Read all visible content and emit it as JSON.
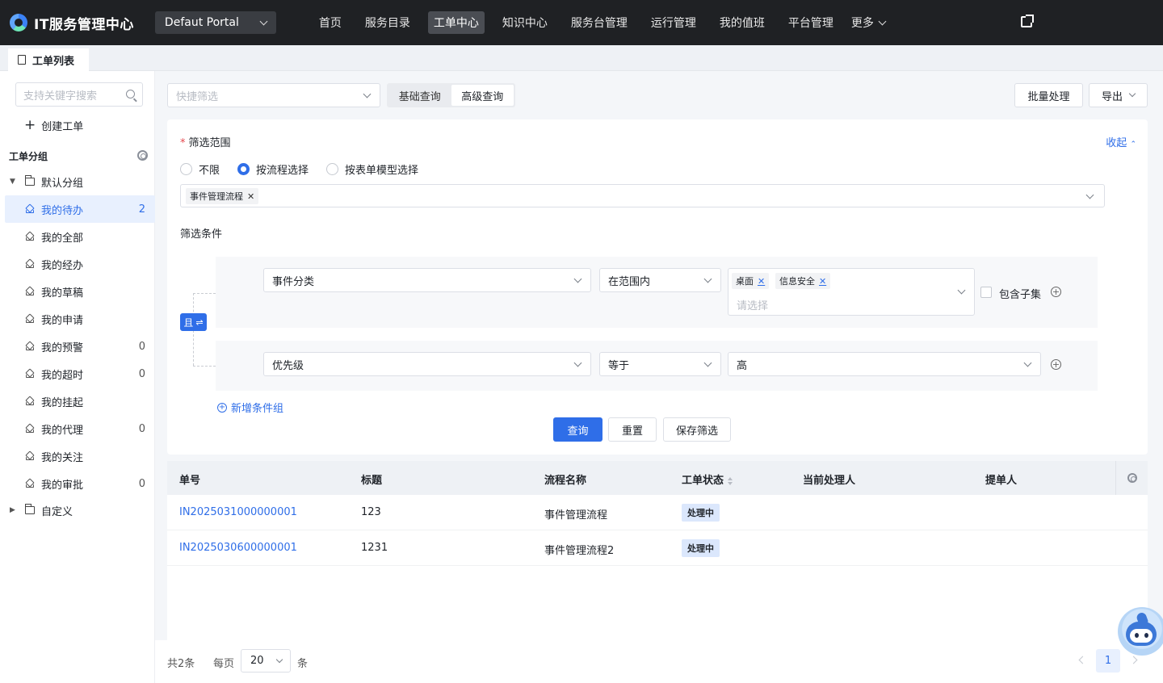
{
  "app": {
    "title": "IT服务管理中心",
    "portal": "Defaut Portal"
  },
  "nav": {
    "items": [
      "首页",
      "服务目录",
      "工单中心",
      "知识中心",
      "服务台管理",
      "运行管理",
      "我的值班",
      "平台管理"
    ],
    "active_index": 2,
    "more": "更多"
  },
  "tab": {
    "label": "工单列表"
  },
  "sidebar": {
    "search_placeholder": "支持关键字搜索",
    "create": "创建工单",
    "group_title": "工单分组",
    "default_group": "默认分组",
    "items": [
      {
        "label": "我的待办",
        "count": "2",
        "active": true
      },
      {
        "label": "我的全部",
        "count": ""
      },
      {
        "label": "我的经办",
        "count": ""
      },
      {
        "label": "我的草稿",
        "count": ""
      },
      {
        "label": "我的申请",
        "count": ""
      },
      {
        "label": "我的预警",
        "count": "0"
      },
      {
        "label": "我的超时",
        "count": "0"
      },
      {
        "label": "我的挂起",
        "count": ""
      },
      {
        "label": "我的代理",
        "count": "0"
      },
      {
        "label": "我的关注",
        "count": ""
      },
      {
        "label": "我的审批",
        "count": "0"
      }
    ],
    "custom_group": "自定义"
  },
  "toolbar": {
    "quick_filter_placeholder": "快捷筛选",
    "basic_query": "基础查询",
    "advanced_query": "高级查询",
    "batch": "批量处理",
    "export": "导出"
  },
  "filter": {
    "scope_label": "筛选范围",
    "collapse": "收起",
    "radio_options": [
      "不限",
      "按流程选择",
      "按表单模型选择"
    ],
    "radio_selected": 1,
    "process_chip": "事件管理流程",
    "conditions_label": "筛选条件",
    "logic": "且",
    "row1": {
      "field": "事件分类",
      "operator": "在范围内",
      "chips": [
        "桌面",
        "信息安全"
      ],
      "placeholder": "请选择",
      "include_sub": "包含子集"
    },
    "row2": {
      "field": "优先级",
      "operator": "等于",
      "value": "高"
    },
    "add_group": "新增条件组",
    "query": "查询",
    "reset": "重置",
    "save": "保存筛选"
  },
  "table": {
    "columns": [
      "单号",
      "标题",
      "流程名称",
      "工单状态",
      "当前处理人",
      "提单人"
    ],
    "rows": [
      {
        "id": "IN2025031000000001",
        "title": "123",
        "process": "事件管理流程",
        "status": "处理中"
      },
      {
        "id": "IN2025030600000001",
        "title": "1231",
        "process": "事件管理流程2",
        "status": "处理中"
      }
    ]
  },
  "pager": {
    "total": "共2条",
    "per_page": "每页",
    "size": "20",
    "unit": "条",
    "current": "1"
  }
}
